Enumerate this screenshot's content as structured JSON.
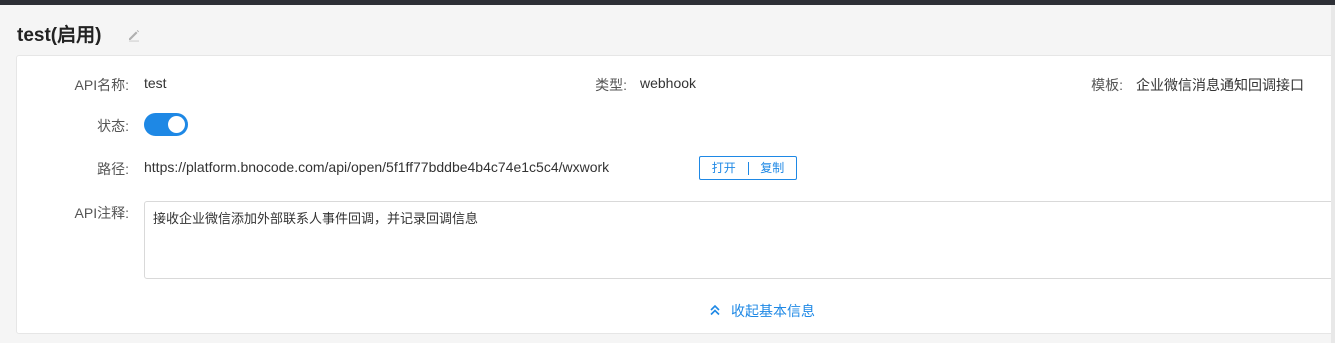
{
  "header": {
    "title": "test(启用)"
  },
  "fields": {
    "api_name_label": "API名称:",
    "api_name_value": "test",
    "type_label": "类型:",
    "type_value": "webhook",
    "template_label": "模板:",
    "template_value": "企业微信消息通知回调接口",
    "status_label": "状态:",
    "path_label": "路径:",
    "path_value": "https://platform.bnocode.com/api/open/5f1ff77bddbe4b4c74e1c5c4/wxwork",
    "note_label": "API注释:",
    "note_value": "接收企业微信添加外部联系人事件回调，并记录回调信息"
  },
  "status_enabled": true,
  "buttons": {
    "open": "打开",
    "copy": "复制"
  },
  "collapse_label": "收起基本信息",
  "colors": {
    "accent": "#1e88e5",
    "topbar": "#2d2f36"
  },
  "icons": {
    "edit": "pencil-icon",
    "collapse": "double-chevron-up-icon"
  }
}
